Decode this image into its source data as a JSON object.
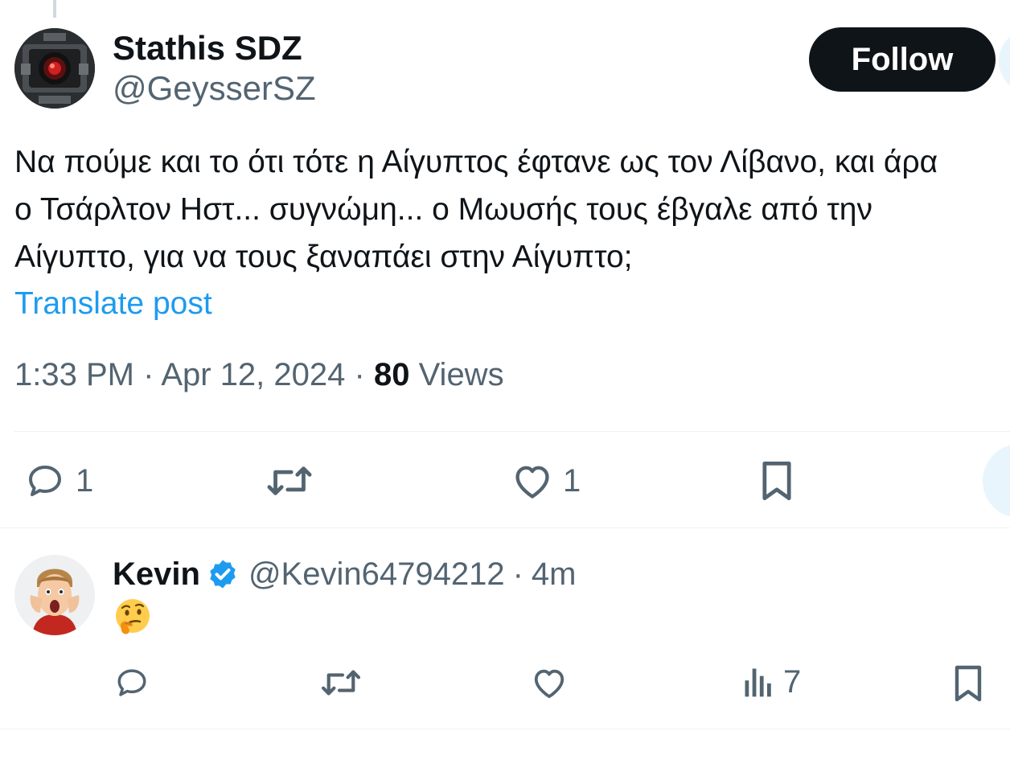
{
  "tweet": {
    "author": {
      "name": "Stathis SDZ",
      "handle": "@GeysserSZ",
      "avatar": "robot-eye-avatar"
    },
    "follow_label": "Follow",
    "text_lines": [
      "Να πούμε και το ότι τότε η Αίγυπτος έφτανε ως τον Λίβανο, και άρα",
      "ο Τσάρλτον Ηστ... συγνώμη... ο Μωυσής τους έβγαλε από την",
      "Αίγυπτο, για να τους ξαναπάει στην Αίγυπτο;"
    ],
    "translate_label": "Translate post",
    "time": "1:33 PM",
    "separator": "·",
    "date": "Apr 12, 2024",
    "views_count": "80",
    "views_label": "Views",
    "actions": {
      "reply": {
        "icon": "reply-icon",
        "count": "1"
      },
      "repost": {
        "icon": "repost-icon",
        "count": ""
      },
      "like": {
        "icon": "heart-icon",
        "count": "1"
      },
      "bookmark": {
        "icon": "bookmark-icon"
      }
    }
  },
  "reply": {
    "name": "Kevin",
    "verified": true,
    "handle": "@Kevin64794212",
    "separator": "·",
    "time": "4m",
    "emoji": "thinking-face-emoji",
    "actions": {
      "reply": {
        "icon": "reply-icon",
        "count": ""
      },
      "repost": {
        "icon": "repost-icon",
        "count": ""
      },
      "like": {
        "icon": "heart-icon",
        "count": ""
      },
      "views": {
        "icon": "views-chart-icon",
        "count": "7"
      },
      "bookmark": {
        "icon": "bookmark-icon"
      }
    }
  },
  "colors": {
    "text": "#0f1419",
    "secondary": "#536471",
    "link": "#1d9bf0",
    "verified": "#1d9bf0",
    "divider": "#eff3f4"
  }
}
